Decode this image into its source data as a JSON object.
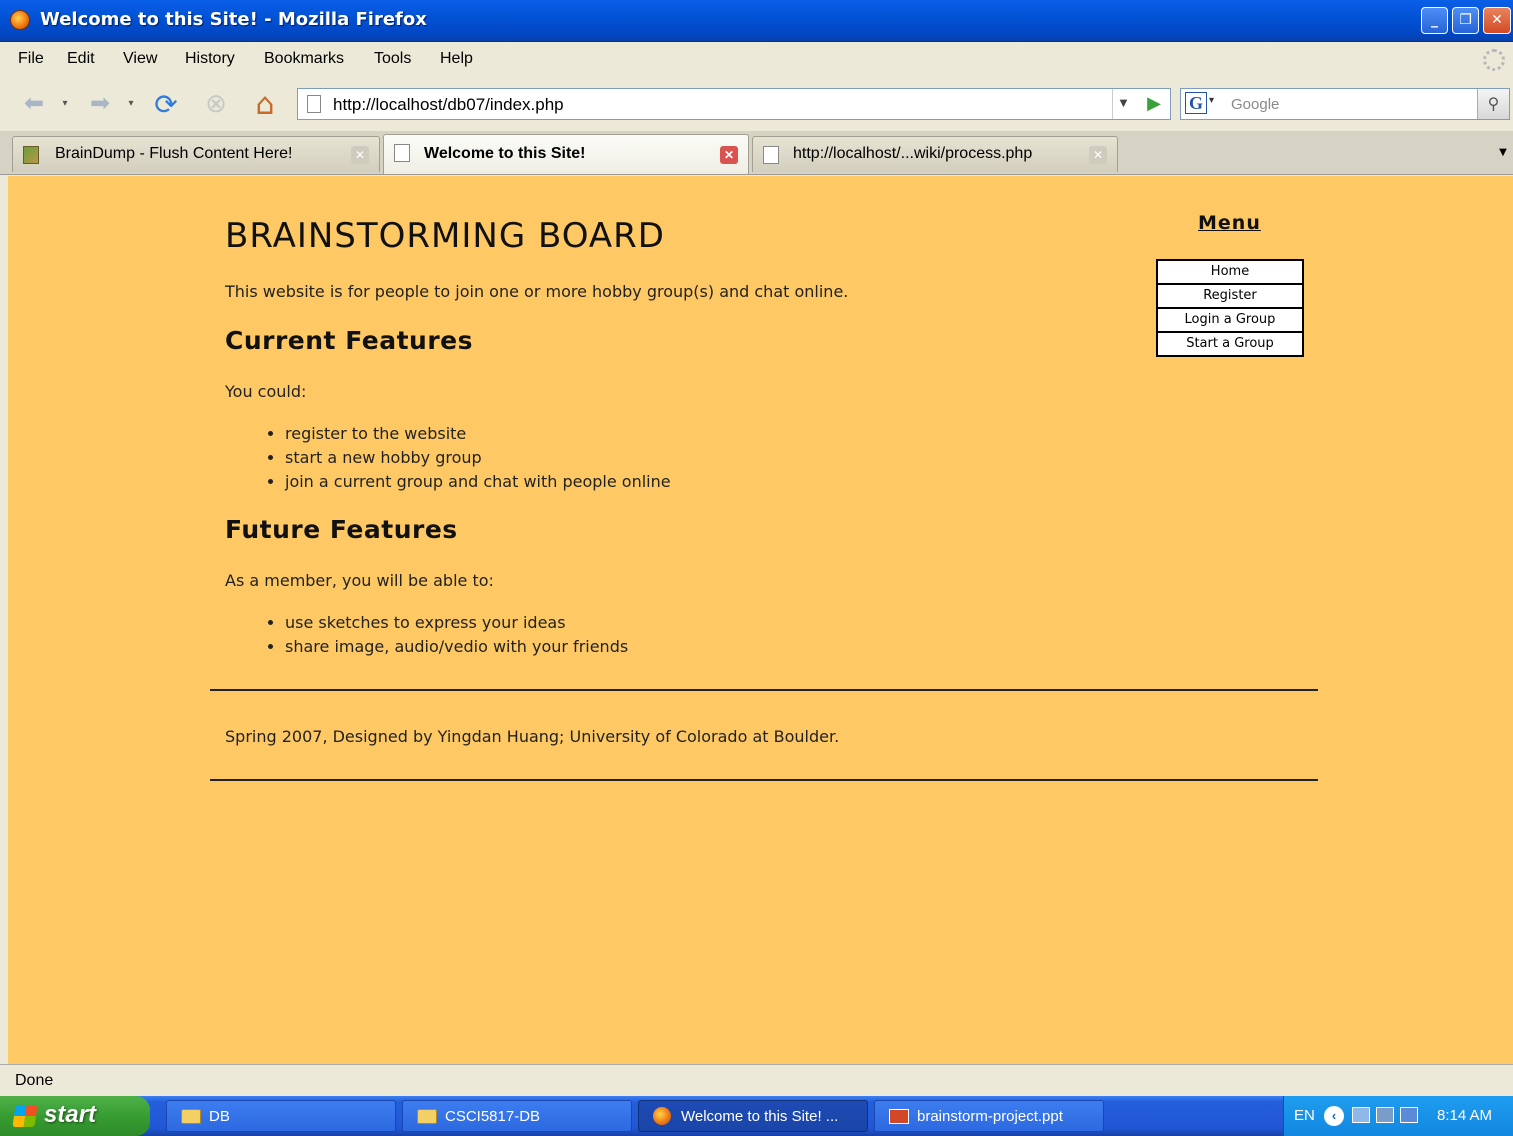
{
  "window": {
    "title": "Welcome to this Site! - Mozilla Firefox"
  },
  "menubar": {
    "items": [
      "File",
      "Edit",
      "View",
      "History",
      "Bookmarks",
      "Tools",
      "Help"
    ]
  },
  "navbar": {
    "url": "http://localhost/db07/index.php",
    "search_placeholder": "Google"
  },
  "tabs": [
    {
      "label": "BrainDump - Flush Content Here!",
      "active": false
    },
    {
      "label": "Welcome to this Site!",
      "active": true
    },
    {
      "label": "http://localhost/...wiki/process.php",
      "active": false
    }
  ],
  "page": {
    "title": "BRAINSTORMING BOARD",
    "intro": "This website is for people to join one or more hobby group(s) and chat online.",
    "current": {
      "heading": "Current Features",
      "lead": "You could:",
      "items": [
        "register to the website",
        "start a new hobby group",
        "join a current group and chat with people online"
      ]
    },
    "future": {
      "heading": "Future Features",
      "lead": "As a member, you will be able to:",
      "items": [
        "use sketches to express your ideas",
        "share image, audio/vedio with your friends"
      ]
    },
    "footer": "Spring 2007, Designed by Yingdan Huang; University of Colorado at Boulder.",
    "menu": {
      "heading": "Menu",
      "items": [
        "Home",
        "Register",
        "Login a Group",
        "Start a Group"
      ]
    }
  },
  "status": {
    "text": "Done"
  },
  "taskbar": {
    "start_label": "start",
    "tasks": [
      "DB",
      "CSCI5817-DB",
      "Welcome to this Site! ...",
      "brainstorm-project.ppt"
    ],
    "tray": {
      "lang": "EN",
      "clock": "8:14 AM"
    }
  },
  "colors": {
    "page_background": "#fec965",
    "titlebar": "#0353d6",
    "taskbar": "#245edb"
  }
}
